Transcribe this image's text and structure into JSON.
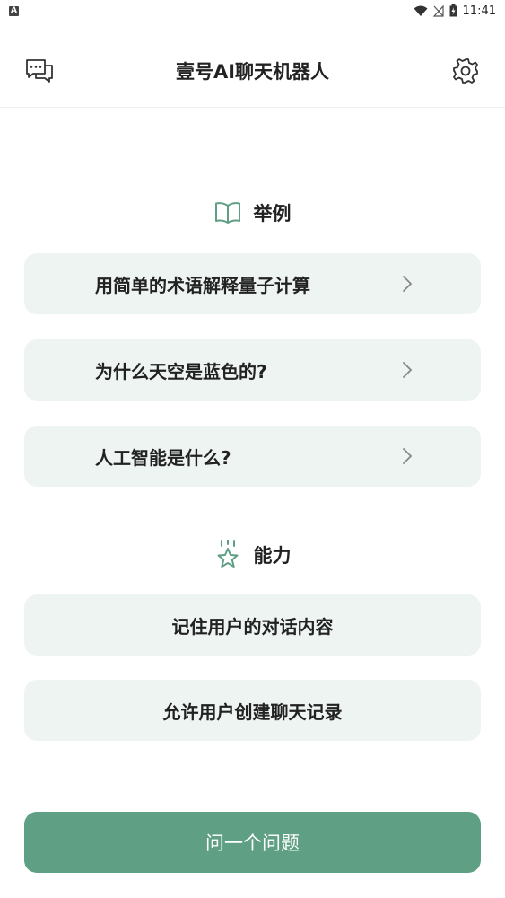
{
  "status_bar": {
    "app_indicator": "A",
    "time": "11:41"
  },
  "header": {
    "title": "壹号AI聊天机器人",
    "left_icon": "chat-bubbles-icon",
    "right_icon": "gear-icon"
  },
  "examples": {
    "heading": "举例",
    "icon": "open-book-icon",
    "items": [
      {
        "label": "用简单的术语解释量子计算"
      },
      {
        "label": "为什么天空是蓝色的?"
      },
      {
        "label": "人工智能是什么?"
      }
    ]
  },
  "capabilities": {
    "heading": "能力",
    "icon": "star-badge-icon",
    "items": [
      {
        "label": "记住用户的对话内容"
      },
      {
        "label": "允许用户创建聊天记录"
      }
    ]
  },
  "ask_button": {
    "label": "问一个问题"
  },
  "colors": {
    "accent": "#5fa084",
    "card_bg": "#eef4f1"
  }
}
